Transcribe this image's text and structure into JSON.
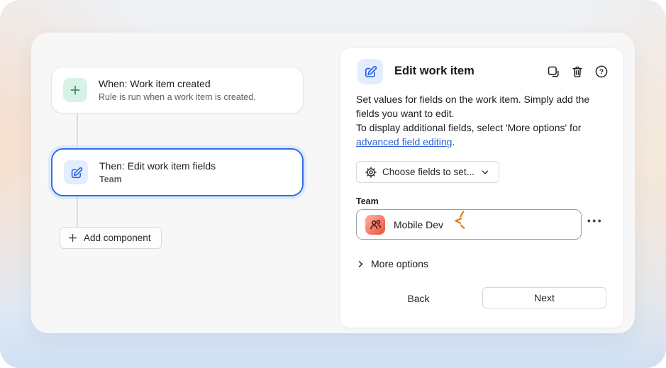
{
  "colors": {
    "selection_blue": "#2e6fe2",
    "icon_blue": "#2563eb",
    "link_blue": "#2b61d3",
    "mint_bg": "#d8f3e5",
    "mint_icon": "#3e8e68",
    "blue_tile_bg": "#e3edfd",
    "team_tile_gradient": [
      "#ffa095",
      "#ef5c49"
    ],
    "spark_orange": "#e8820e",
    "canvas_bg": "#f7f7f8"
  },
  "icons": {
    "trigger": "plus-icon",
    "action": "edit-pencil-icon",
    "header_actions": [
      "duplicate-icon",
      "trash-icon",
      "help-icon"
    ],
    "choose_fields": "gear-icon",
    "team_value": "team-people-icon",
    "attention": "spark-click-icon"
  },
  "flow": {
    "trigger": {
      "title": "When: Work item created",
      "subtitle": "Rule is run when a work item is created."
    },
    "action": {
      "title": "Then: Edit work item fields",
      "subtitle": "Team"
    },
    "add_component_label": "Add component"
  },
  "panel": {
    "title": "Edit work item",
    "description_line1": "Set values for fields on the work item. Simply add the fields you want to edit.",
    "description_prefix": "To display additional fields, select 'More options' for ",
    "description_link": "advanced field editing",
    "description_suffix": ".",
    "choose_fields_label": "Choose fields to set...",
    "team_field": {
      "label": "Team",
      "value": "Mobile Dev",
      "more_label": "•••"
    },
    "more_options_label": "More options",
    "back_label": "Back",
    "next_label": "Next"
  }
}
